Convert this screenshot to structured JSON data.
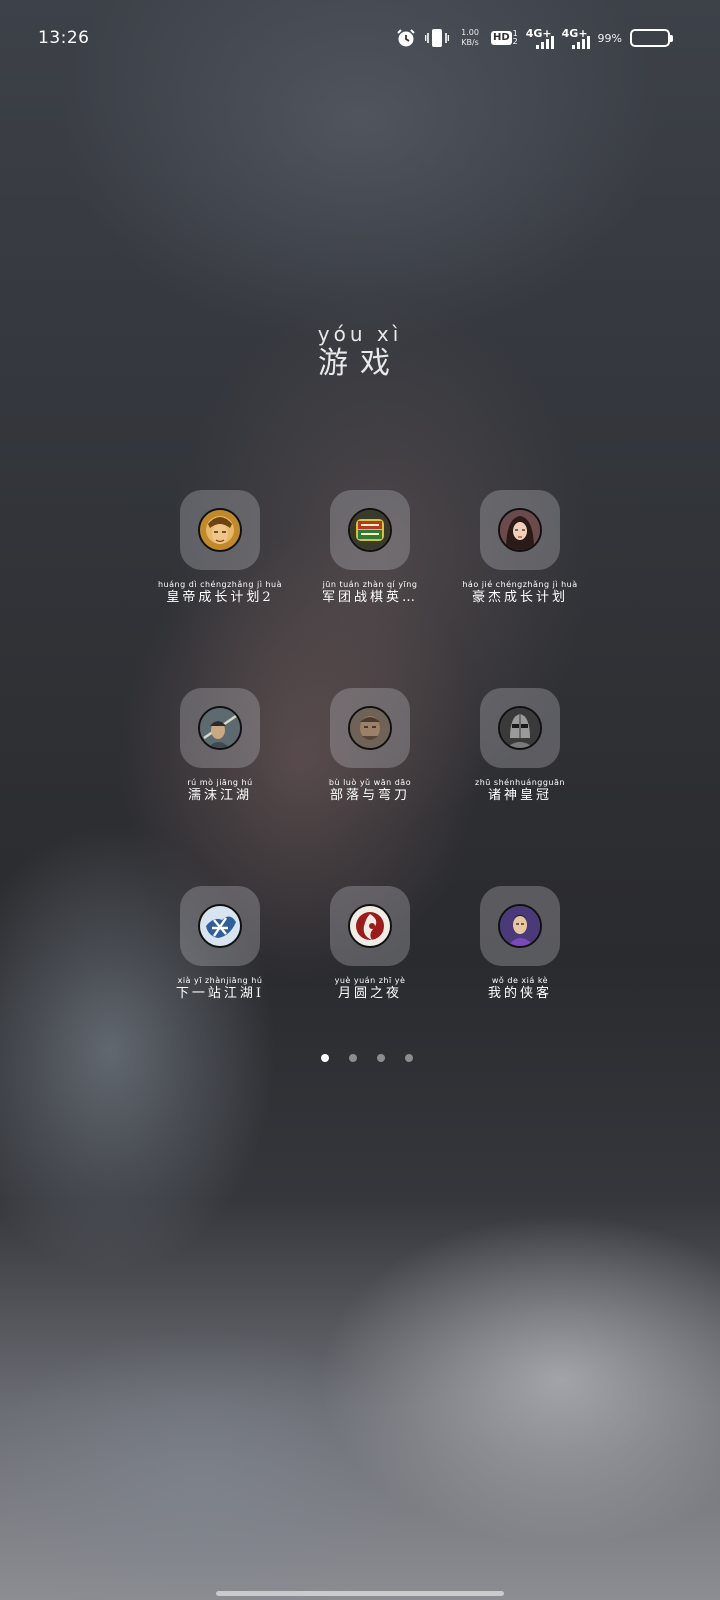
{
  "status_bar": {
    "time": "13:26",
    "speed_value": "1.00",
    "speed_unit": "KB/s",
    "hd_label": "HD",
    "hd_sub_top": "1",
    "hd_sub_bottom": "2",
    "net1_label": "4G+",
    "net2_label": "4G+",
    "battery_percent": "99%",
    "battery_level": 0.99,
    "icons": [
      "alarm-icon",
      "vibrate-icon",
      "hd-voice-icon",
      "signal-icon",
      "battery-icon"
    ]
  },
  "folder": {
    "title_pinyin": "yóu xì",
    "title": "游戏"
  },
  "apps": [
    {
      "pinyin": "huáng dì chéngzhǎng jì huà",
      "name": "皇帝成长计划2",
      "icon": "emperor-avatar-icon"
    },
    {
      "pinyin": "jūn tuán zhàn qí yīng",
      "name": "军团战棋英…",
      "icon": "legion-chess-logo-icon"
    },
    {
      "pinyin": "háo jié chéngzhǎng jì huà",
      "name": "豪杰成长计划",
      "icon": "heroine-avatar-icon"
    },
    {
      "pinyin": "rú mò jiāng hú",
      "name": "濡沫江湖",
      "icon": "swordsman-avatar-icon"
    },
    {
      "pinyin": "bù luò yǔ wān dāo",
      "name": "部落与弯刀",
      "icon": "tribe-warrior-avatar-icon"
    },
    {
      "pinyin": "zhū shénhuángguān",
      "name": "诸神皇冠",
      "icon": "armored-knight-avatar-icon"
    },
    {
      "pinyin": "xià yī zhànjiāng hú",
      "name": "下一站江湖Ⅰ",
      "icon": "ink-character-logo-icon"
    },
    {
      "pinyin": "yuè yuán zhī yè",
      "name": "月圆之夜",
      "icon": "red-moon-logo-icon"
    },
    {
      "pinyin": "wǒ de xiá kè",
      "name": "我的侠客",
      "icon": "purple-hero-avatar-icon"
    }
  ],
  "pager": {
    "count": 4,
    "active_index": 0
  }
}
